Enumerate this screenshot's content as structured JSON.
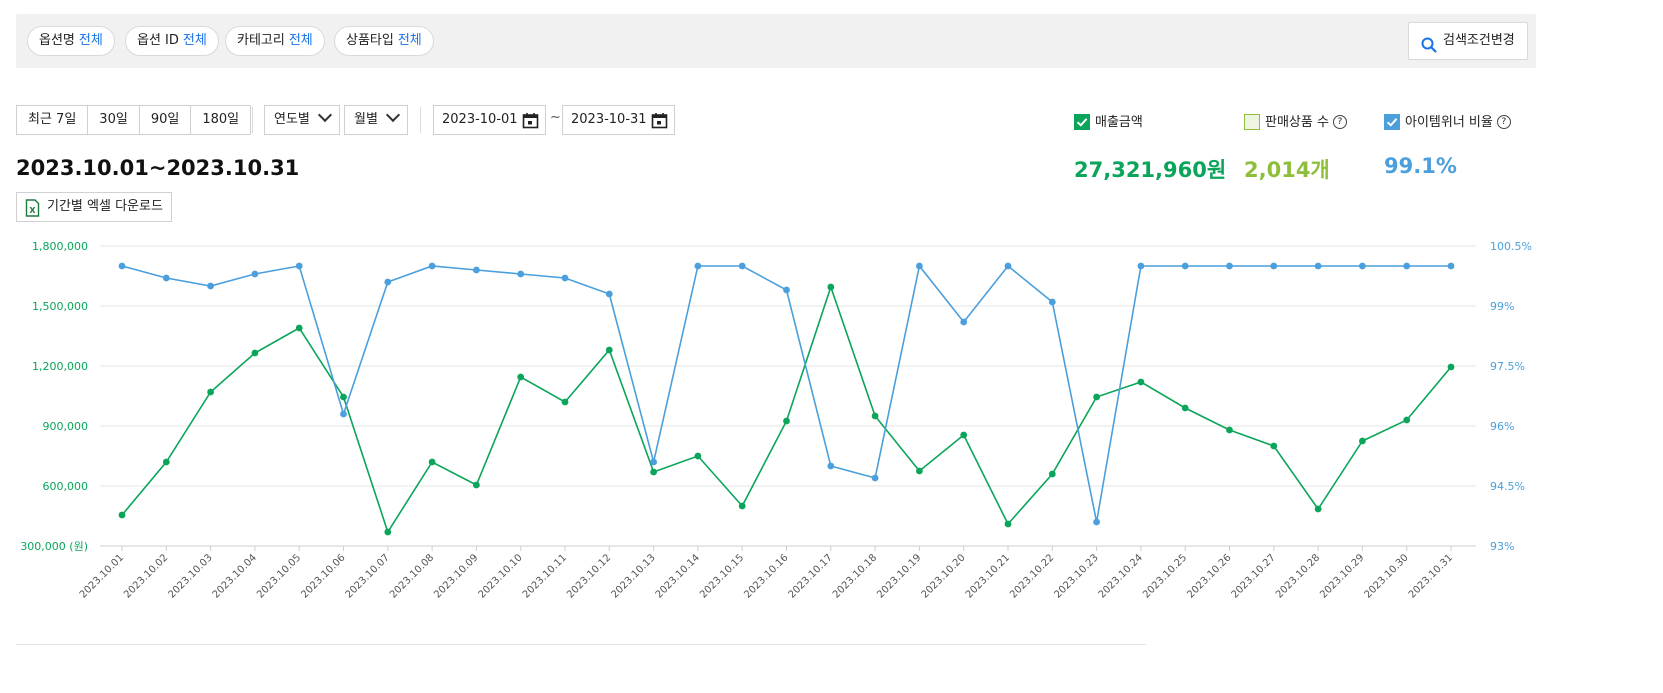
{
  "filters": {
    "chips": [
      {
        "label": "옵션명",
        "value": "전체"
      },
      {
        "label": "옵션 ID",
        "value": "전체"
      },
      {
        "label": "카테고리",
        "value": "전체"
      },
      {
        "label": "상품타입",
        "value": "전체"
      }
    ],
    "search_button": "검색조건변경"
  },
  "period_buttons": [
    "최근 7일",
    "30일",
    "90일",
    "180일"
  ],
  "selects": {
    "year": "연도별",
    "month": "월별"
  },
  "date_range": {
    "start": "2023-10-01",
    "separator": "~",
    "end": "2023-10-31"
  },
  "period_title": "2023.10.01~2023.10.31",
  "excel_button": "기간별 엑셀 다운로드",
  "legend": [
    {
      "label": "매출금액",
      "checked": true,
      "color": "#0aa55a",
      "help": false
    },
    {
      "label": "판매상품 수",
      "checked": false,
      "color": "#8fbf3a",
      "help": true
    },
    {
      "label": "아이템위너 비율",
      "checked": true,
      "color": "#4a9fdc",
      "help": true
    }
  ],
  "stats": {
    "sales": "27,321,960원",
    "items": "2,014개",
    "winner_ratio": "99.1%"
  },
  "colors": {
    "sales": "#0aa55a",
    "items": "#8fbf3a",
    "ratio": "#4a9fdc",
    "link": "#1a73e8"
  },
  "chart_data": {
    "type": "line",
    "categories": [
      "2023.10.01",
      "2023.10.02",
      "2023.10.03",
      "2023.10.04",
      "2023.10.05",
      "2023.10.06",
      "2023.10.07",
      "2023.10.08",
      "2023.10.09",
      "2023.10.10",
      "2023.10.11",
      "2023.10.12",
      "2023.10.13",
      "2023.10.14",
      "2023.10.15",
      "2023.10.16",
      "2023.10.17",
      "2023.10.18",
      "2023.10.19",
      "2023.10.20",
      "2023.10.21",
      "2023.10.22",
      "2023.10.23",
      "2023.10.24",
      "2023.10.25",
      "2023.10.26",
      "2023.10.27",
      "2023.10.28",
      "2023.10.29",
      "2023.10.30",
      "2023.10.31"
    ],
    "series": [
      {
        "name": "매출금액",
        "axis": "left",
        "color": "#0aa55a",
        "values": [
          455000,
          720000,
          1070000,
          1265000,
          1390000,
          1045000,
          370000,
          720000,
          605000,
          1145000,
          1020000,
          1280000,
          670000,
          750000,
          500000,
          925000,
          1595000,
          950000,
          675000,
          855000,
          410000,
          660000,
          1045000,
          1120000,
          990000,
          880000,
          800000,
          485000,
          825000,
          930000,
          1195000
        ]
      },
      {
        "name": "아이템위너 비율",
        "axis": "right",
        "color": "#4a9fdc",
        "values": [
          100.0,
          99.7,
          99.5,
          99.8,
          100.0,
          96.3,
          99.6,
          100.0,
          99.9,
          99.8,
          99.7,
          99.3,
          95.1,
          100.0,
          100.0,
          99.4,
          95.0,
          94.7,
          100.0,
          98.6,
          100.0,
          99.1,
          93.6,
          100.0,
          100.0,
          100.0,
          100.0,
          100.0,
          100.0,
          100.0,
          100.0
        ]
      }
    ],
    "left_axis": {
      "ticks": [
        "1,800,000",
        "1,500,000",
        "1,200,000",
        "900,000",
        "600,000",
        "300,000 (원)"
      ],
      "ylim": [
        300000,
        1800000
      ]
    },
    "right_axis": {
      "ticks": [
        "100.5%",
        "99%",
        "97.5%",
        "96%",
        "94.5%",
        "93%"
      ],
      "ylim": [
        93,
        100.5
      ]
    },
    "grid": true
  }
}
